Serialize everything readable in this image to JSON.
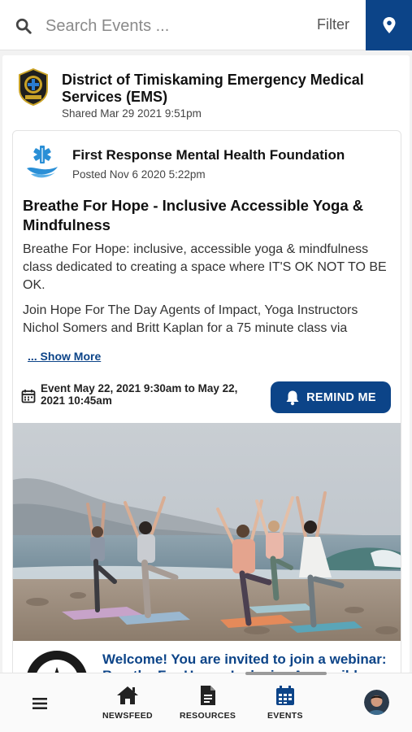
{
  "search": {
    "placeholder": "Search Events ...",
    "filter_label": "Filter"
  },
  "post": {
    "org_name": "District of Timiskaming Emergency Medical Services (EMS)",
    "shared": "Shared Mar 29 2021 9:51pm",
    "event": {
      "org_name": "First Response Mental Health Foundation",
      "posted": "Posted Nov 6 2020 5:22pm",
      "title": "Breathe For Hope - Inclusive Accessible Yoga & Mindfulness",
      "description_1": "Breathe For Hope: inclusive, accessible yoga & mindfulness class dedicated to creating a space where IT'S OK NOT TO BE OK.",
      "description_2": "Join Hope For The Day Agents of Impact, Yoga Instructors Nichol Somers and Britt Kaplan for a 75 minute class via",
      "show_more": "... Show More",
      "date": "Event May 22, 2021 9:30am to May 22, 2021 10:45am",
      "remind_label": "REMIND ME",
      "webinar_text": "Welcome! You are invited to join a webinar: Breathe For Hope - Inclusive Accessible"
    }
  },
  "nav": {
    "items": [
      {
        "label": "NEWSFEED",
        "icon": "home-icon"
      },
      {
        "label": "RESOURCES",
        "icon": "document-icon"
      },
      {
        "label": "EVENTS",
        "icon": "calendar-icon"
      }
    ]
  },
  "colors": {
    "brand": "#0c4488",
    "accent_light": "#2a8fd6"
  }
}
